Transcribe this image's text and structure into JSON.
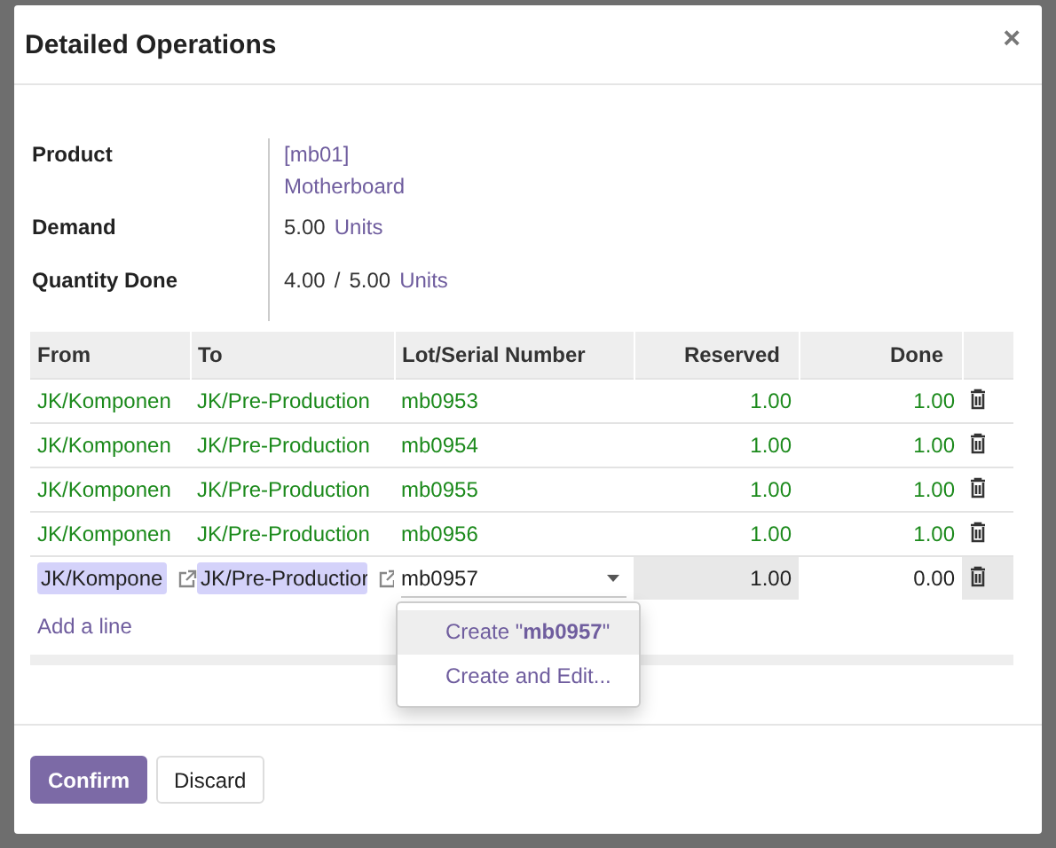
{
  "dialog": {
    "title": "Detailed Operations",
    "close": "×"
  },
  "fields": [
    {
      "label": "Product",
      "kind": "link",
      "lines": [
        "[mb01]",
        "Motherboard"
      ]
    },
    {
      "label": "Demand",
      "kind": "qty",
      "parts": [
        "5.00"
      ],
      "unit": "Units"
    },
    {
      "label": "Quantity Done",
      "kind": "qty",
      "parts": [
        "4.00",
        "/",
        "5.00"
      ],
      "unit": "Units"
    }
  ],
  "table": {
    "columns": [
      "From",
      "To",
      "Lot/Serial Number",
      "Reserved",
      "Done"
    ],
    "rows": [
      {
        "kind": "line",
        "from": "JK/Komponen",
        "to": "JK/Pre-Production",
        "lot": "mb0953",
        "reserved": "1.00",
        "done": "1.00"
      },
      {
        "kind": "line",
        "from": "JK/Komponen",
        "to": "JK/Pre-Production",
        "lot": "mb0954",
        "reserved": "1.00",
        "done": "1.00"
      },
      {
        "kind": "line",
        "from": "JK/Komponen",
        "to": "JK/Pre-Production",
        "lot": "mb0955",
        "reserved": "1.00",
        "done": "1.00"
      },
      {
        "kind": "line",
        "from": "JK/Komponen",
        "to": "JK/Pre-Production",
        "lot": "mb0956",
        "reserved": "1.00",
        "done": "1.00"
      },
      {
        "kind": "edit",
        "from": "JK/Kompone",
        "to": "JK/Pre-Productior",
        "lot": "mb0957",
        "reserved": "1.00",
        "done": "0.00"
      }
    ],
    "add_line": "Add a line"
  },
  "dropdown": [
    {
      "label": "Create \"**mb0957**\"",
      "selected": true
    },
    {
      "label": "Create and Edit...",
      "selected": false
    }
  ],
  "buttons": [
    {
      "label": "Confirm",
      "kind": "primary"
    },
    {
      "label": "Discard",
      "kind": "secondary"
    }
  ]
}
